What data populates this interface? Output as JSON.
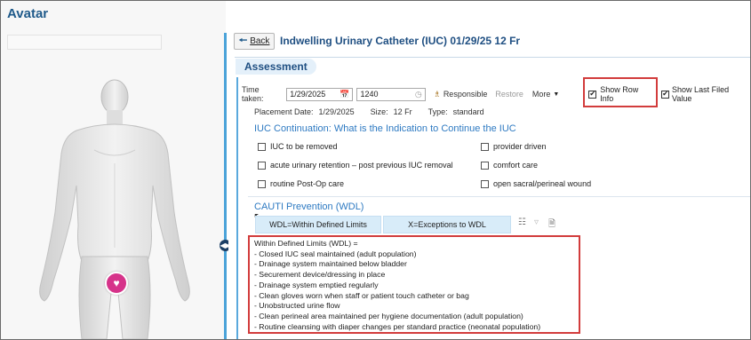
{
  "avatar": {
    "title": "Avatar",
    "badge_icon": "catheter-icon"
  },
  "header": {
    "back_label": "Back",
    "title": "Indwelling Urinary Catheter (IUC) 01/29/25 12 Fr"
  },
  "assessment": {
    "tab_label": "Assessment",
    "time_taken_label": "Time taken:",
    "date_value": "1/29/2025",
    "time_value": "1240",
    "responsible_label": "Responsible",
    "restore_label": "Restore",
    "more_label": "More",
    "show_row_info_label": "Show Row Info",
    "show_last_filed_label": "Show Last Filed Value",
    "show_row_info_checked": true,
    "show_last_filed_checked": true
  },
  "placement": {
    "date_label": "Placement Date:",
    "date_value": "1/29/2025",
    "size_label": "Size:",
    "size_value": "12 Fr",
    "type_label": "Type:",
    "type_value": "standard"
  },
  "continuation": {
    "heading": "IUC Continuation: What is the Indication to Continue the IUC",
    "options": [
      "IUC to be removed",
      "provider driven",
      "acute urinary retention – post previous IUC removal",
      "comfort care",
      "routine Post-Op care",
      "open sacral/perineal wound"
    ]
  },
  "cauti": {
    "heading": "CAUTI Prevention (WDL)",
    "wdl_button": "WDL=Within Defined Limits",
    "x_button": "X=Exceptions to WDL",
    "wdl_lines": [
      "Within Defined Limits (WDL) =",
      "- Closed IUC seal maintained (adult population)",
      "- Drainage system maintained below bladder",
      "- Securement device/dressing in place",
      "- Drainage system emptied regularly",
      "- Clean gloves worn when staff or patient touch catheter or bag",
      "- Unobstructed urine flow",
      "- Clean perineal area maintained per hygiene documentation (adult population)",
      "- Routine cleansing with diaper changes per standard practice (neonatal population)"
    ]
  },
  "colors": {
    "accent": "#1f4f82",
    "highlight": "#d23c3c",
    "badge": "#d6338a"
  }
}
